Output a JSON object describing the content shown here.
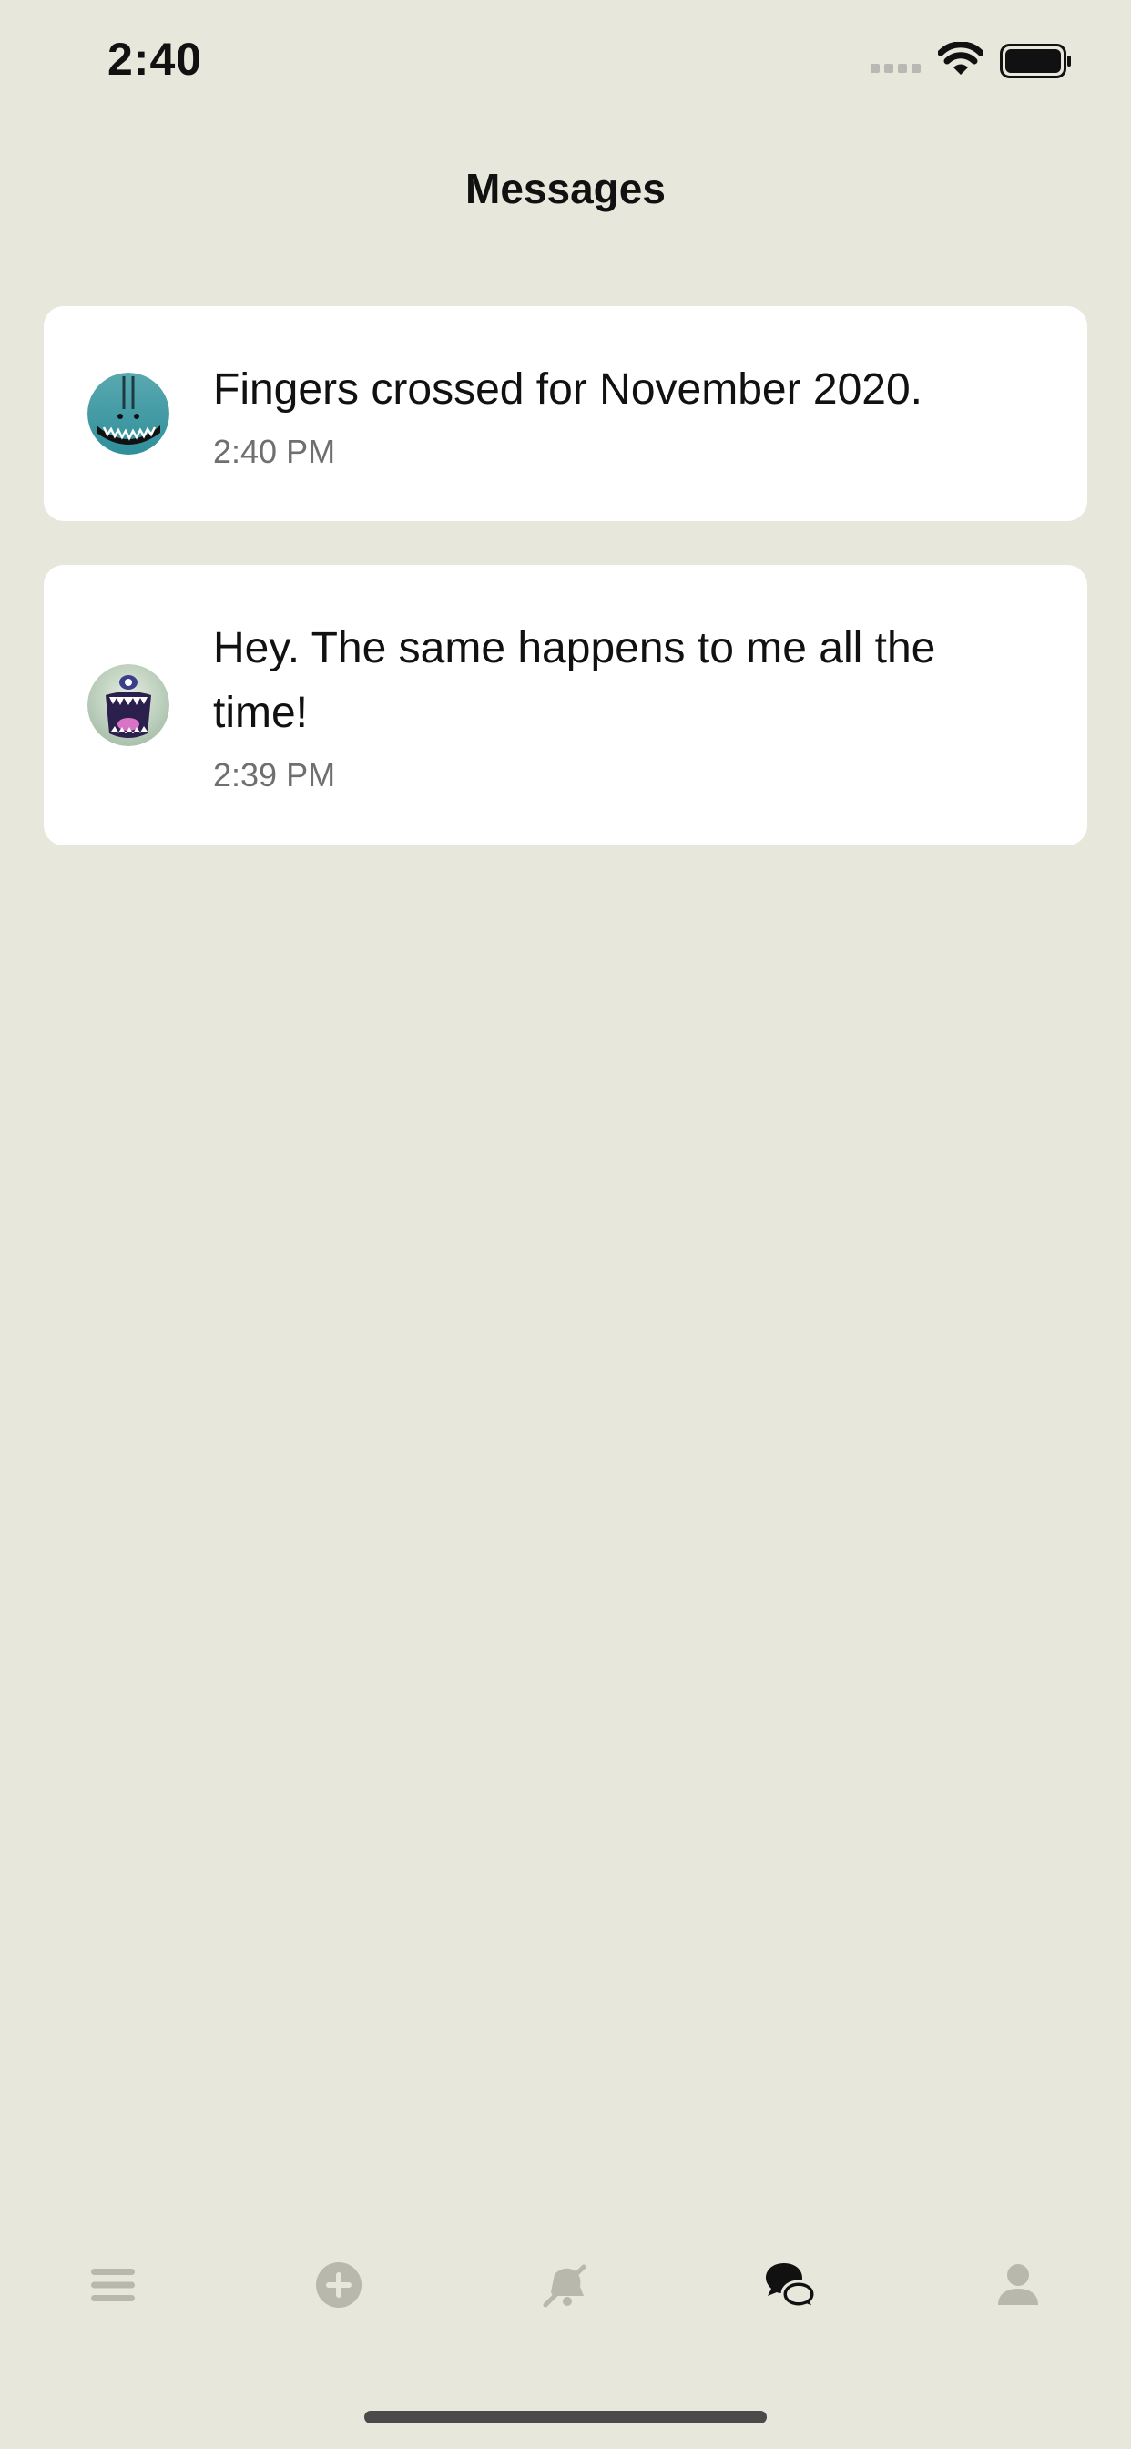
{
  "status_bar": {
    "time": "2:40",
    "signal_icon": "cellular-signal-icon",
    "wifi_icon": "wifi-icon",
    "battery_icon": "battery-icon"
  },
  "header": {
    "title": "Messages"
  },
  "messages": [
    {
      "text": "Fingers crossed for November 2020.",
      "time": "2:40 PM",
      "avatar": "monster-avatar-teal"
    },
    {
      "text": "Hey. The same happens to me all the time!",
      "time": "2:39 PM",
      "avatar": "monster-avatar-green"
    }
  ],
  "tab_bar": {
    "tabs": [
      {
        "icon": "menu-icon",
        "active": false
      },
      {
        "icon": "add-circle-icon",
        "active": false
      },
      {
        "icon": "bell-off-icon",
        "active": false
      },
      {
        "icon": "chat-bubbles-icon",
        "active": true
      },
      {
        "icon": "profile-icon",
        "active": false
      }
    ]
  },
  "colors": {
    "background": "#e7e7dc",
    "card": "#ffffff",
    "tab_inactive": "#b8b8ad",
    "tab_active": "#111111",
    "secondary_text": "#6f6f6f"
  }
}
